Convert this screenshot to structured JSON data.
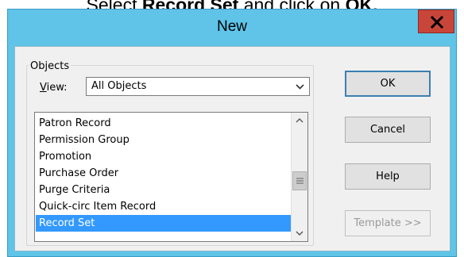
{
  "instruction": {
    "prefix": "Select ",
    "emphasis1": "Record Set",
    "middle": " and click on ",
    "emphasis2": "OK."
  },
  "dialog": {
    "title": "New",
    "close_glyph": "X"
  },
  "objects_group": {
    "label": "Objects",
    "view_label": "View:",
    "view_value": "All Objects"
  },
  "list": {
    "items": [
      "Patron Record",
      "Permission Group",
      "Promotion",
      "Purchase Order",
      "Purge Criteria",
      "Quick-circ Item Record",
      "Record Set"
    ],
    "selected": "Record Set"
  },
  "buttons": {
    "ok": "OK",
    "cancel": "Cancel",
    "help": "Help",
    "template": "Template >>"
  },
  "colors": {
    "title_bar": "#5fc4e8",
    "close_button": "#c8453a",
    "selection": "#3399ff"
  }
}
